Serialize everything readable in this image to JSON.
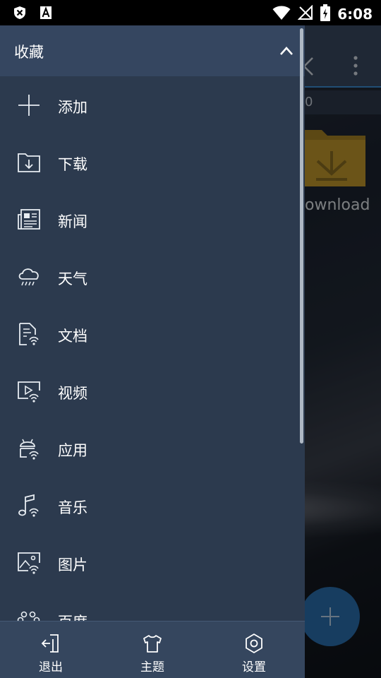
{
  "status_bar": {
    "time": "6:08",
    "left_icons": [
      "close-shield-icon",
      "font-a-icon"
    ],
    "right_icons": [
      "wifi-icon",
      "no-signal-icon",
      "battery-charging-icon"
    ]
  },
  "background_app": {
    "path_text": "0",
    "folder_label": "ownload"
  },
  "drawer": {
    "title": "收藏",
    "items": [
      {
        "label": "添加",
        "icon": "add-icon"
      },
      {
        "label": "下载",
        "icon": "download-folder-icon"
      },
      {
        "label": "新闻",
        "icon": "news-icon"
      },
      {
        "label": "天气",
        "icon": "weather-icon"
      },
      {
        "label": "文档",
        "icon": "document-icon"
      },
      {
        "label": "视频",
        "icon": "video-icon"
      },
      {
        "label": "应用",
        "icon": "android-icon"
      },
      {
        "label": "音乐",
        "icon": "music-icon"
      },
      {
        "label": "图片",
        "icon": "image-icon"
      },
      {
        "label": "百度",
        "icon": "baidu-icon"
      }
    ],
    "bottom": {
      "exit_label": "退出",
      "theme_label": "主题",
      "settings_label": "设置"
    }
  },
  "colors": {
    "drawer_bg": "#2c3a4e",
    "header_bg": "#354660",
    "accent": "#3d8fd6"
  }
}
